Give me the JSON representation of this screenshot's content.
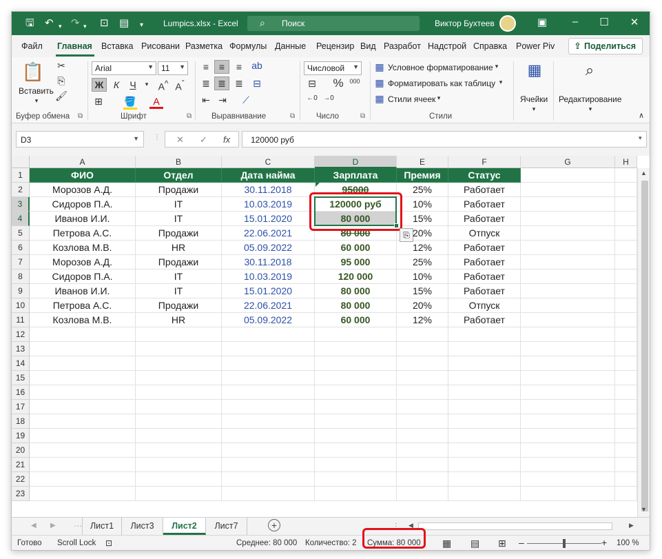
{
  "titlebar": {
    "file_name": "Lumpics.xlsx",
    "sep": "-",
    "app_name": "Excel",
    "search_placeholder": "Поиск",
    "user_name": "Виктор Бухтеев"
  },
  "menu": {
    "tabs": [
      "Файл",
      "Главная",
      "Вставка",
      "Рисовани",
      "Разметка",
      "Формулы",
      "Данные",
      "Рецензир",
      "Вид",
      "Разработ",
      "Надстрой",
      "Справка",
      "Power Piv"
    ],
    "share_label": "Поделиться"
  },
  "ribbon": {
    "paste_label": "Вставить",
    "font_name": "Arial",
    "font_size": "11",
    "bold": "Ж",
    "italic": "К",
    "underline": "Ч",
    "number_format": "Числовой",
    "cond_format": "Условное форматирование",
    "format_table": "Форматировать как таблицу",
    "cell_styles": "Стили ячеек",
    "cells_label": "Ячейки",
    "editing_label": "Редактирование",
    "groups": [
      "Буфер обмена",
      "Шрифт",
      "Выравнивание",
      "Число",
      "Стили"
    ]
  },
  "formula_bar": {
    "name_box": "D3",
    "fx": "fx",
    "content": "120000 руб"
  },
  "grid": {
    "columns": [
      "A",
      "B",
      "C",
      "D",
      "E",
      "F",
      "G",
      "H"
    ],
    "rows": [
      "1",
      "2",
      "3",
      "4",
      "5",
      "6",
      "7",
      "8",
      "9",
      "10",
      "11",
      "12",
      "13",
      "14",
      "15",
      "16",
      "17",
      "18",
      "19",
      "20",
      "21",
      "22",
      "23"
    ],
    "header": [
      "ФИО",
      "Отдел",
      "Дата найма",
      "Зарплата",
      "Премия",
      "Статус"
    ],
    "data": [
      [
        "Морозов А.Д.",
        "Продажи",
        "30.11.2018",
        "95000",
        "25%",
        "Работает"
      ],
      [
        "Сидоров П.А.",
        "IT",
        "10.03.2019",
        "120000 руб",
        "10%",
        "Работает"
      ],
      [
        "Иванов И.И.",
        "IT",
        "15.01.2020",
        "80 000",
        "15%",
        "Работает"
      ],
      [
        "Петрова А.С.",
        "Продажи",
        "22.06.2021",
        "80 000",
        "20%",
        "Отпуск"
      ],
      [
        "Козлова М.В.",
        "HR",
        "05.09.2022",
        "60 000",
        "12%",
        "Работает"
      ],
      [
        "Морозов А.Д.",
        "Продажи",
        "30.11.2018",
        "95 000",
        "25%",
        "Работает"
      ],
      [
        "Сидоров П.А.",
        "IT",
        "10.03.2019",
        "120 000",
        "10%",
        "Работает"
      ],
      [
        "Иванов И.И.",
        "IT",
        "15.01.2020",
        "80 000",
        "15%",
        "Работает"
      ],
      [
        "Петрова А.С.",
        "Продажи",
        "22.06.2021",
        "80 000",
        "20%",
        "Отпуск"
      ],
      [
        "Козлова М.В.",
        "HR",
        "05.09.2022",
        "60 000",
        "12%",
        "Работает"
      ]
    ]
  },
  "sheets": {
    "tabs": [
      "Лист1",
      "Лист3",
      "Лист2",
      "Лист7"
    ],
    "active": "Лист2",
    "add": "+"
  },
  "status": {
    "ready": "Готово",
    "scroll_lock": "Scroll Lock",
    "average": "Среднее: 80 000",
    "count": "Количество: 2",
    "sum": "Сумма: 80 000",
    "zoom": "100 %"
  },
  "colors": {
    "accent": "#217346",
    "highlight": "#e3121b"
  }
}
